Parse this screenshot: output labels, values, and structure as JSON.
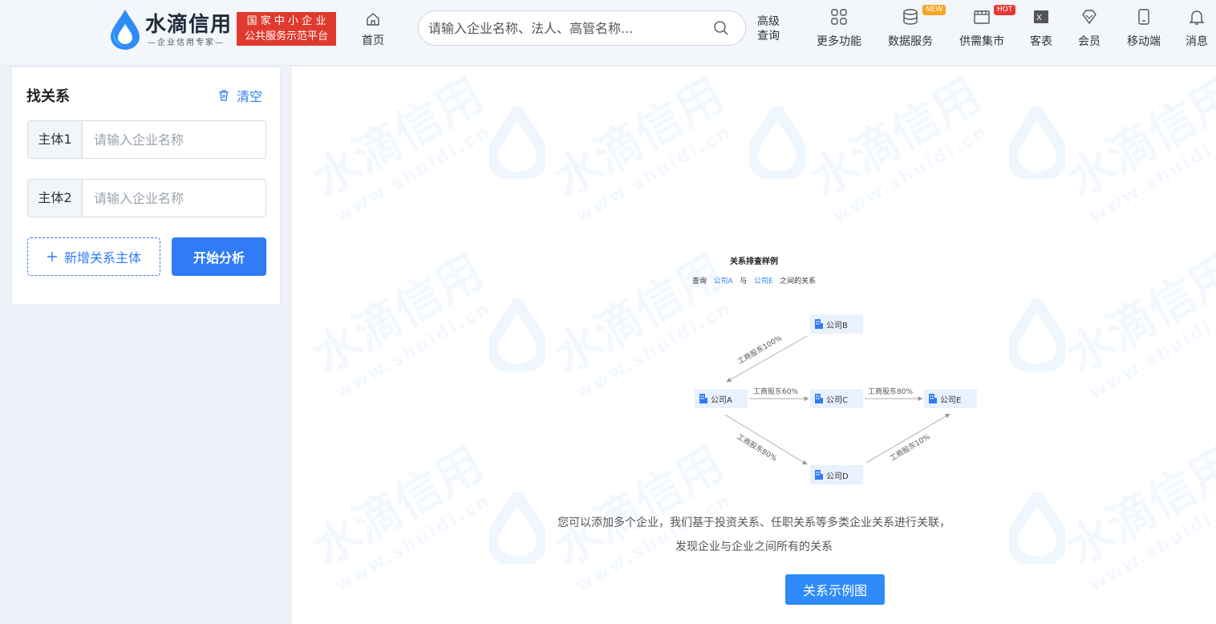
{
  "brand": {
    "name": "水滴信用",
    "slogan": "—企业信用专家—",
    "badge_line1": "国 家 中 小 企 业",
    "badge_line2": "公共服务示范平台",
    "color": "#2f7cf6",
    "badge_color": "#e03a2f"
  },
  "header": {
    "home_label": "首页",
    "search_placeholder": "请输入企业名称、法人、高管名称...",
    "advanced_line1": "高级",
    "advanced_line2": "查询",
    "nav": [
      {
        "label": "更多功能",
        "icon": "grid-icon"
      },
      {
        "label": "数据服务",
        "icon": "database-icon",
        "tag": "NEW"
      },
      {
        "label": "供需集市",
        "icon": "market-icon",
        "tag": "HOT"
      },
      {
        "label": "客表",
        "icon": "excel-icon"
      },
      {
        "label": "会员",
        "icon": "diamond-icon"
      },
      {
        "label": "移动端",
        "icon": "mobile-icon"
      },
      {
        "label": "消息",
        "icon": "bell-icon"
      }
    ]
  },
  "panel": {
    "title": "找关系",
    "clear_label": "清空",
    "field1_label": "主体1",
    "field1_placeholder": "请输入企业名称",
    "field2_label": "主体2",
    "field2_placeholder": "请输入企业名称",
    "add_label": "新增关系主体",
    "start_label": "开始分析"
  },
  "example": {
    "title": "关系排查样例",
    "sub_prefix": "查询",
    "sub_a": "公司A",
    "sub_mid": "与",
    "sub_e": "公司E",
    "sub_suffix": "之间的关系",
    "nodes": {
      "a": "公司A",
      "b": "公司B",
      "c": "公司C",
      "d": "公司D",
      "e": "公司E"
    },
    "edges": {
      "ba": "工商股东100%",
      "ac": "工商股东60%",
      "ce": "工商股东80%",
      "ad": "工商股东80%",
      "de": "工商股东10%"
    },
    "desc_line1": "您可以添加多个企业，我们基于投资关系、任职关系等多类企业关系进行关联，",
    "desc_line2": "发现企业与企业之间所有的关系",
    "button_label": "关系示例图"
  },
  "watermark": {
    "text": "水滴信用",
    "url": "www.shuidi.cn"
  }
}
